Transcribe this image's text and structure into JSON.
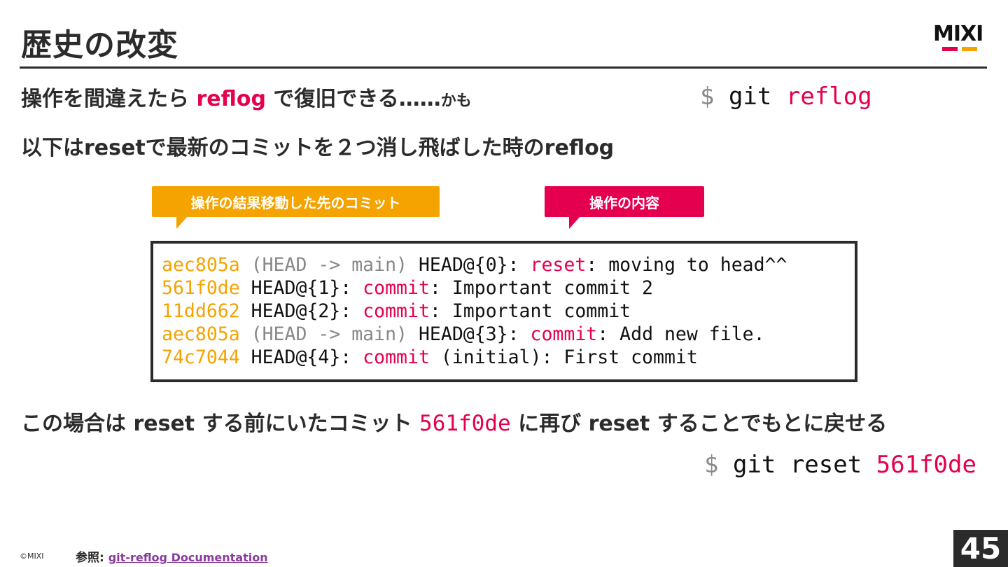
{
  "slide": {
    "title": "歴史の改変",
    "page_number": "45",
    "copyright": "©MIXI",
    "logo_text": "MIXI"
  },
  "intro": {
    "line1_prefix": "操作を間違えたら ",
    "line1_highlight": "reflog",
    "line1_suffix": " で復旧できる……",
    "line1_small": "かも",
    "line2": "以下はresetで最新のコミットを２つ消し飛ばした時のreflog"
  },
  "command1": {
    "prompt": "$",
    "cmd": " git ",
    "arg": "reflog"
  },
  "callouts": {
    "left": "操作の結果移動した先のコミット",
    "right": "操作の内容"
  },
  "reflog": [
    {
      "hash": "aec805a",
      "ref": " (HEAD -> main)",
      "head": " HEAD@{0}: ",
      "action": "reset",
      "message": ": moving to head^^"
    },
    {
      "hash": "561f0de",
      "ref": "",
      "head": " HEAD@{1}: ",
      "action": "commit",
      "message": ": Important commit 2"
    },
    {
      "hash": "11dd662",
      "ref": "",
      "head": " HEAD@{2}: ",
      "action": "commit",
      "message": ": Important commit"
    },
    {
      "hash": "aec805a",
      "ref": " (HEAD -> main)",
      "head": " HEAD@{3}: ",
      "action": "commit",
      "message": ": Add new file."
    },
    {
      "hash": "74c7044",
      "ref": "",
      "head": " HEAD@{4}: ",
      "action": "commit",
      "message": " (initial): First commit"
    }
  ],
  "conclusion": {
    "prefix": "この場合は reset する前にいたコミット ",
    "hash": "561f0de",
    "suffix": " に再び reset することでもとに戻せる"
  },
  "command2": {
    "prompt": "$",
    "cmd": " git reset ",
    "arg": "561f0de"
  },
  "reference": {
    "label": "参照: ",
    "link_text": "git-reflog Documentation"
  },
  "colors": {
    "accent_pink": "#e5004f",
    "accent_orange": "#f4a300",
    "text_dark": "#2b2b2b",
    "muted_gray": "#888888"
  }
}
